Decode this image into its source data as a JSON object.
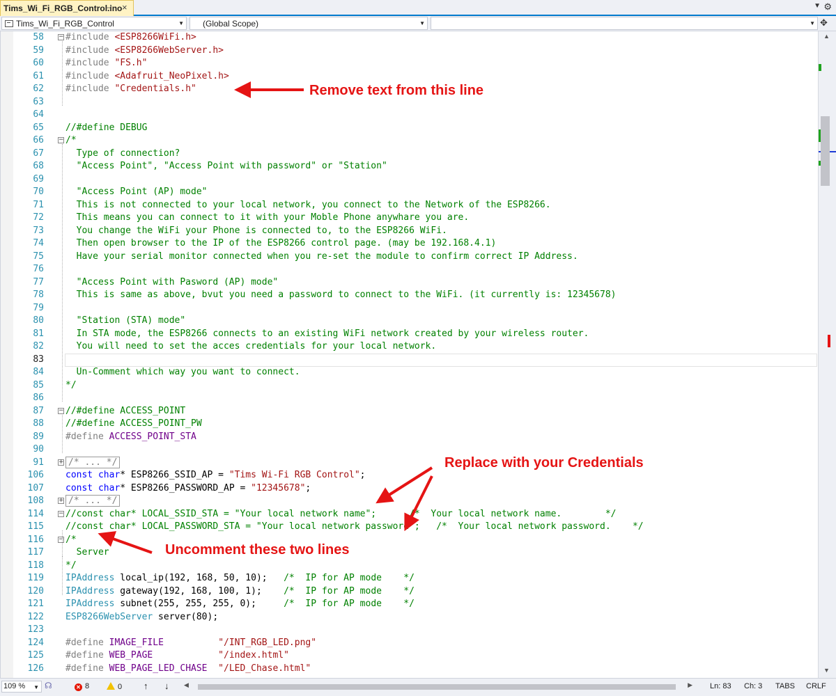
{
  "tab": {
    "title": "Tims_Wi_Fi_RGB_Control.ino",
    "pin_icon": "pin-icon",
    "close_glyph": "×"
  },
  "navbar": {
    "project": "Tims_Wi_Fi_RGB_Control",
    "scope": "(Global Scope)",
    "member": ""
  },
  "lines": [
    {
      "n": "58",
      "fold": "minus",
      "html": "<span class='c-pre'>#include </span><span class='c-str'>&lt;ESP8266WiFi.h&gt;</span>"
    },
    {
      "n": "59",
      "html": "<span class='c-pre'>#include </span><span class='c-str'>&lt;ESP8266WebServer.h&gt;</span>"
    },
    {
      "n": "60",
      "html": "<span class='c-pre'>#include </span><span class='c-str'>\"FS.h\"</span>"
    },
    {
      "n": "61",
      "html": "<span class='c-pre'>#include </span><span class='c-str'>&lt;Adafruit_NeoPixel.h&gt;</span>"
    },
    {
      "n": "62",
      "html": "<span class='c-pre'>#include </span><span class='c-str'>\"Credentials.h\"</span>"
    },
    {
      "n": "63",
      "html": ""
    },
    {
      "n": "64",
      "html": ""
    },
    {
      "n": "65",
      "html": "<span class='c-com'>//#define DEBUG</span>"
    },
    {
      "n": "66",
      "fold": "minus",
      "html": "<span class='c-com'>/*</span>"
    },
    {
      "n": "67",
      "html": "<span class='c-com'>  Type of connection?</span>"
    },
    {
      "n": "68",
      "html": "<span class='c-com'>  \"Access Point\", \"Access Point with password\" or \"Station\"</span>"
    },
    {
      "n": "69",
      "html": ""
    },
    {
      "n": "70",
      "html": "<span class='c-com'>  \"Access Point (AP) mode\"</span>"
    },
    {
      "n": "71",
      "html": "<span class='c-com'>  This is not connected to your local network, you connect to the Network of the ESP8266.</span>"
    },
    {
      "n": "72",
      "html": "<span class='c-com'>  This means you can connect to it with your Moble Phone anywhare you are.</span>"
    },
    {
      "n": "73",
      "html": "<span class='c-com'>  You change the WiFi your Phone is connected to, to the ESP8266 WiFi.</span>"
    },
    {
      "n": "74",
      "html": "<span class='c-com'>  Then open browser to the IP of the ESP8266 control page. (may be 192.168.4.1)</span>"
    },
    {
      "n": "75",
      "html": "<span class='c-com'>  Have your serial monitor connected when you re-set the module to confirm correct IP Address.</span>"
    },
    {
      "n": "76",
      "html": ""
    },
    {
      "n": "77",
      "html": "<span class='c-com'>  \"Access Point with Pasword (AP) mode\"</span>"
    },
    {
      "n": "78",
      "html": "<span class='c-com'>  This is same as above, bvut you need a password to connect to the WiFi. (it currently is: 12345678)</span>"
    },
    {
      "n": "79",
      "html": ""
    },
    {
      "n": "80",
      "html": "<span class='c-com'>  \"Station (STA) mode\"</span>"
    },
    {
      "n": "81",
      "html": "<span class='c-com'>  In STA mode, the ESP8266 connects to an existing WiFi network created by your wireless router.</span>"
    },
    {
      "n": "82",
      "html": "<span class='c-com'>  You will need to set the acces credentials for your local network.</span>"
    },
    {
      "n": "83",
      "cur": true,
      "html": ""
    },
    {
      "n": "84",
      "html": "<span class='c-com'>  Un-Comment which way you want to connect.</span>"
    },
    {
      "n": "85",
      "html": "<span class='c-com'>*/</span>"
    },
    {
      "n": "86",
      "html": ""
    },
    {
      "n": "87",
      "fold": "minus",
      "html": "<span class='c-com'>//#define ACCESS_POINT</span>"
    },
    {
      "n": "88",
      "html": "<span class='c-com'>//#define ACCESS_POINT_PW</span>"
    },
    {
      "n": "89",
      "html": "<span class='c-pre'>#define </span><span class='c-mac'>ACCESS_POINT_STA</span>"
    },
    {
      "n": "90",
      "html": ""
    },
    {
      "n": "91",
      "fold": "plus",
      "html": "<span class='collapsed'>/* ... */</span>"
    },
    {
      "n": "106",
      "html": "<span class='c-kw'>const </span><span class='c-kw'>char</span><span class='c-txt'>* ESP8266_SSID_AP = </span><span class='c-str'>\"Tims Wi-Fi RGB Control\"</span><span class='c-txt'>;</span>"
    },
    {
      "n": "107",
      "html": "<span class='c-kw'>const </span><span class='c-kw'>char</span><span class='c-txt'>* ESP8266_PASSWORD_AP = </span><span class='c-str'>\"12345678\"</span><span class='c-txt'>;</span>"
    },
    {
      "n": "108",
      "fold": "plus",
      "html": "<span class='collapsed'>/* ... */</span>"
    },
    {
      "n": "114",
      "fold": "minus",
      "html": "<span class='c-com'>//const char* LOCAL_SSID_STA = \"Your local network name\";      /*  Your local network name.        */</span>"
    },
    {
      "n": "115",
      "html": "<span class='c-com'>//const char* LOCAL_PASSWORD_STA = \"Your local network password\";   /*  Your local network password.    */</span>"
    },
    {
      "n": "116",
      "fold": "minus",
      "html": "<span class='c-com'>/*</span>"
    },
    {
      "n": "117",
      "html": "<span class='c-com'>  Server</span>"
    },
    {
      "n": "118",
      "html": "<span class='c-com'>*/</span>"
    },
    {
      "n": "119",
      "html": "<span class='c-type'>IPAddress</span><span class='c-txt'> local_ip(192, 168, 50, 10);   </span><span class='c-com'>/*  IP for AP mode    */</span>"
    },
    {
      "n": "120",
      "html": "<span class='c-type'>IPAddress</span><span class='c-txt'> gateway(192, 168, 100, 1);    </span><span class='c-com'>/*  IP for AP mode    */</span>"
    },
    {
      "n": "121",
      "html": "<span class='c-type'>IPAddress</span><span class='c-txt'> subnet(255, 255, 255, 0);     </span><span class='c-com'>/*  IP for AP mode    */</span>"
    },
    {
      "n": "122",
      "html": "<span class='c-type'>ESP8266WebServer</span><span class='c-txt'> server(80);</span>"
    },
    {
      "n": "123",
      "html": ""
    },
    {
      "n": "124",
      "html": "<span class='c-pre'>#define </span><span class='c-mac'>IMAGE_FILE</span><span class='c-txt'>          </span><span class='c-str'>\"/INT_RGB_LED.png\"</span>"
    },
    {
      "n": "125",
      "html": "<span class='c-pre'>#define </span><span class='c-mac'>WEB_PAGE</span><span class='c-txt'>            </span><span class='c-str'>\"/index.html\"</span>"
    },
    {
      "n": "126",
      "html": "<span class='c-pre'>#define </span><span class='c-mac'>WEB_PAGE_LED_CHASE</span><span class='c-txt'>  </span><span class='c-str'>\"/LED_Chase.html\"</span>"
    }
  ],
  "annotations": {
    "remove": "Remove text from this line",
    "replace": "Replace with your Credentials",
    "uncomment": "Uncomment these two lines"
  },
  "status": {
    "zoom": "109 %",
    "errors": "8",
    "warnings": "0",
    "up": "↑",
    "down": "↓",
    "ln": "Ln: 83",
    "ch": "Ch: 3",
    "tabs": "TABS",
    "eol": "CRLF"
  },
  "colors": {
    "annotation": "#e51414",
    "accent": "#007acc",
    "comment": "#008000",
    "string": "#a31515",
    "keyword": "#0000ff"
  }
}
